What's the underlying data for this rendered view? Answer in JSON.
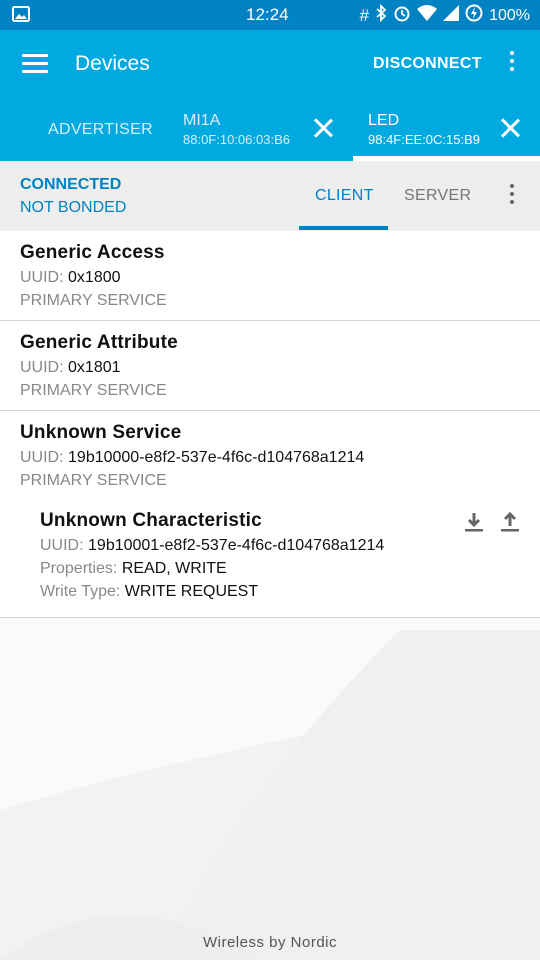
{
  "status_bar": {
    "time": "12:24",
    "battery": "100%",
    "icons": [
      "image-icon",
      "hash-icon",
      "bluetooth-icon",
      "alarm-icon",
      "wifi-icon",
      "signal-icon",
      "data-saver-icon"
    ]
  },
  "toolbar": {
    "title": "Devices",
    "disconnect_label": "DISCONNECT"
  },
  "device_tabs": {
    "advertiser_label": "ADVERTISER",
    "devices": [
      {
        "name": "MI1A",
        "address": "88:0F:10:06:03:B6"
      },
      {
        "name": "LED",
        "address": "98:4F:EE:0C:15:B9"
      }
    ]
  },
  "connection": {
    "status": "CONNECTED",
    "bond": "NOT BONDED",
    "tabs": [
      "CLIENT",
      "SERVER"
    ]
  },
  "services": [
    {
      "title": "Generic Access",
      "uuid_label": "UUID:",
      "uuid": "0x1800",
      "type": "PRIMARY SERVICE"
    },
    {
      "title": "Generic Attribute",
      "uuid_label": "UUID:",
      "uuid": "0x1801",
      "type": "PRIMARY SERVICE"
    },
    {
      "title": "Unknown Service",
      "uuid_label": "UUID:",
      "uuid": "19b10000-e8f2-537e-4f6c-d104768a1214",
      "type": "PRIMARY SERVICE",
      "characteristic": {
        "title": "Unknown Characteristic",
        "uuid_label": "UUID:",
        "uuid": "19b10001-e8f2-537e-4f6c-d104768a1214",
        "properties_label": "Properties:",
        "properties": "READ, WRITE",
        "write_type_label": "Write Type:",
        "write_type": "WRITE REQUEST"
      }
    }
  ],
  "footer": "Wireless by Nordic",
  "colors": {
    "status_bar": "#0082c3",
    "toolbar": "#00a9e0",
    "accent": "#0082c3"
  }
}
